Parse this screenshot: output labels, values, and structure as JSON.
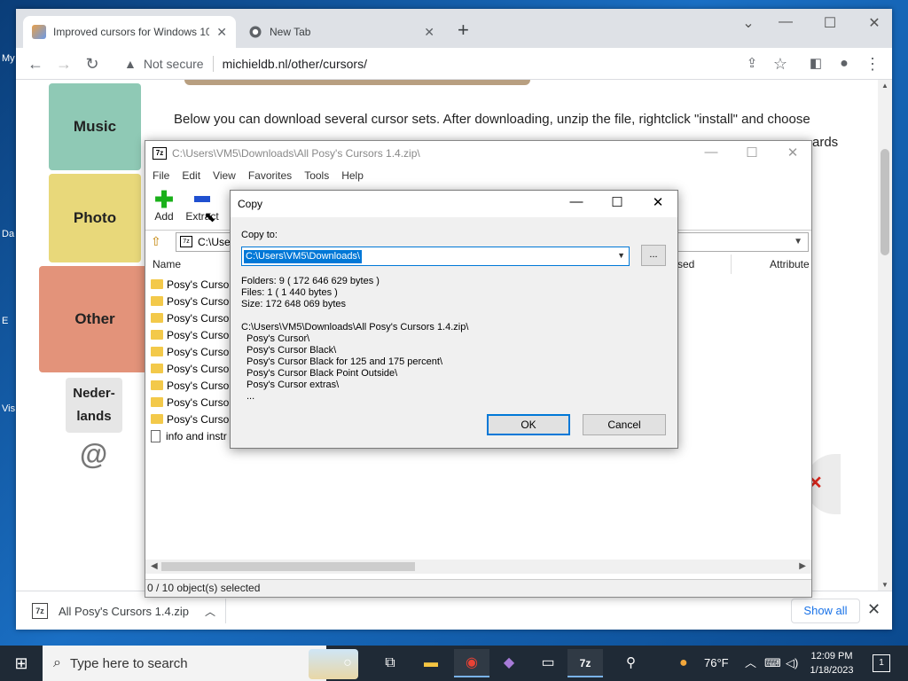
{
  "desktop": {
    "labels": [
      "My",
      "Da",
      "E",
      "Vis"
    ]
  },
  "browser": {
    "tabs": [
      {
        "title": "Improved cursors for Windows 10"
      },
      {
        "title": "New Tab"
      }
    ],
    "security_label": "Not secure",
    "url": "michieldb.nl/other/cursors/",
    "page": {
      "nav_tiles": [
        "Music",
        "Photo",
        "Other",
        "Neder-\nlands"
      ],
      "at_symbol": "@",
      "text_line1": "Below you can download several cursor sets. After downloading, unzip the file, rightclick \"install\" and choose",
      "text_line2_end": "ards"
    },
    "downloads": {
      "file_name": "All Posy's Cursors 1.4.zip",
      "show_all": "Show all"
    }
  },
  "zip_window": {
    "title": "C:\\Users\\VM5\\Downloads\\All Posy's Cursors 1.4.zip\\",
    "menu": [
      "File",
      "Edit",
      "View",
      "Favorites",
      "Tools",
      "Help"
    ],
    "tools": [
      {
        "label": "Add"
      },
      {
        "label": "Extract"
      }
    ],
    "address": "C:\\User",
    "columns": [
      "Name",
      "sed",
      "Attribute"
    ],
    "files": [
      {
        "name": "Posy's Cursor",
        "type": "folder"
      },
      {
        "name": "Posy's Cursor",
        "type": "folder"
      },
      {
        "name": "Posy's Cursor",
        "type": "folder"
      },
      {
        "name": "Posy's Cursor",
        "type": "folder"
      },
      {
        "name": "Posy's Cursor",
        "type": "folder"
      },
      {
        "name": "Posy's Cursor",
        "type": "folder"
      },
      {
        "name": "Posy's Cursor",
        "type": "folder"
      },
      {
        "name": "Posy's Cursor",
        "type": "folder"
      },
      {
        "name": "Posy's Cursor",
        "type": "folder"
      },
      {
        "name": "info and instr",
        "type": "file"
      }
    ],
    "status": "0 / 10 object(s) selected"
  },
  "copy_dialog": {
    "title": "Copy",
    "copy_to_label": "Copy to:",
    "copy_to_value": "C:\\Users\\VM5\\Downloads\\",
    "browse_label": "...",
    "folders": "Folders: 9     ( 172 646 629 bytes )",
    "files": "Files: 1     ( 1 440 bytes )",
    "size": "Size: 172 648 069 bytes",
    "source": "C:\\Users\\VM5\\Downloads\\All Posy's Cursors 1.4.zip\\",
    "items": [
      "Posy's Cursor\\",
      "Posy's Cursor Black\\",
      "Posy's Cursor Black for 125 and 175 percent\\",
      "Posy's Cursor Black Point Outside\\",
      "Posy's Cursor extras\\",
      "..."
    ],
    "ok_label": "OK",
    "cancel_label": "Cancel"
  },
  "taskbar": {
    "search_placeholder": "Type here to search",
    "weather": "76°F",
    "time": "12:09 PM",
    "date": "1/18/2023",
    "notification_count": "1"
  },
  "colors": {
    "accent": "#0078d7",
    "taskbar": "#1f2a36",
    "tile_music": "#8fc9b5",
    "tile_photo": "#e8d87a",
    "tile_other": "#e3937a"
  }
}
